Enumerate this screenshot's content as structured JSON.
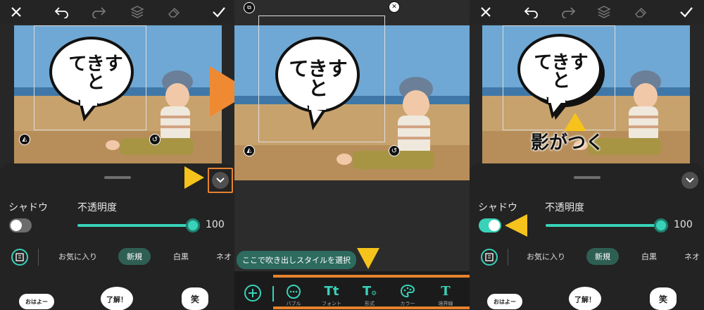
{
  "panel1": {
    "shadow_label": "シャドウ",
    "opacity_label": "不透明度",
    "opacity_value": "100",
    "shadow_enabled": false,
    "categories": [
      "お気に入り",
      "新規",
      "白黒",
      "ネオ"
    ],
    "selected_category": "新規",
    "bubble_text_line1": "てきす",
    "bubble_text_line2": "と",
    "stickers": [
      "おはよー",
      "了解！",
      "笑"
    ]
  },
  "panel2": {
    "bubble_text_line1": "てきす",
    "bubble_text_line2": "と",
    "tooltip": "ここで吹き出しスタイルを選択",
    "tools": [
      {
        "label": "バブル",
        "icon": "bubble-icon"
      },
      {
        "label": "フォント",
        "icon": "font-icon"
      },
      {
        "label": "形式",
        "icon": "format-icon"
      },
      {
        "label": "カラー",
        "icon": "palette-icon"
      },
      {
        "label": "境界線",
        "icon": "border-icon"
      }
    ]
  },
  "panel3": {
    "shadow_label": "シャドウ",
    "opacity_label": "不透明度",
    "opacity_value": "100",
    "shadow_enabled": true,
    "categories": [
      "お気に入り",
      "新規",
      "白黒",
      "ネオ"
    ],
    "selected_category": "新規",
    "bubble_text_line1": "てきす",
    "bubble_text_line2": "と",
    "annotation": "影がつく",
    "stickers": [
      "おはよー",
      "了解！",
      "笑"
    ]
  },
  "colors": {
    "accent": "#39d2b8",
    "orange": "#e7822e",
    "yellow": "#f5c31c",
    "selected_chip": "#2f5f52"
  }
}
